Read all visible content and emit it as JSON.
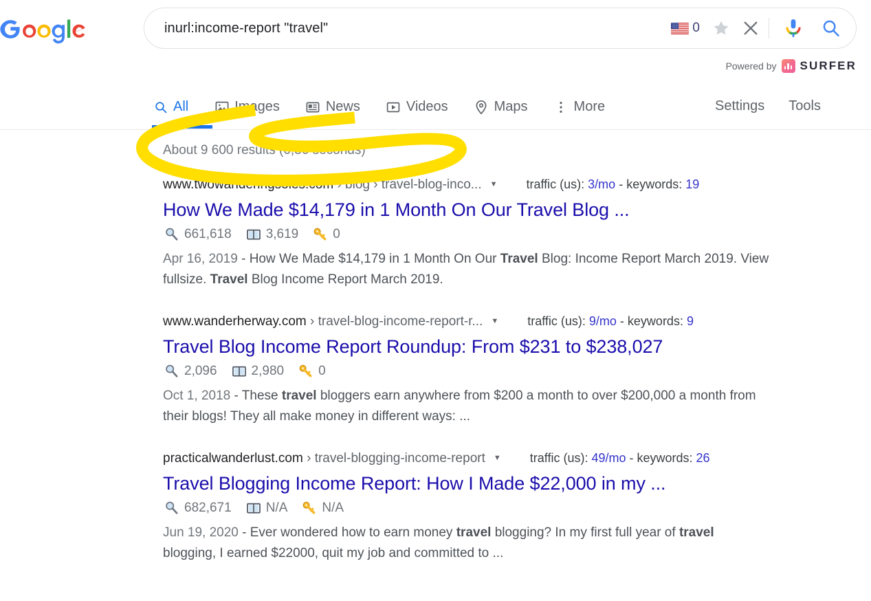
{
  "brand": {
    "logo_name": "google-logo",
    "logo_letters": "Google",
    "colors": {
      "blue": "#4285f4",
      "red": "#ea4335",
      "yellow": "#fbbc05",
      "green": "#34a853",
      "link": "#1a0dab",
      "tab_active": "#1a73e8",
      "highlight": "#ffde00"
    }
  },
  "search": {
    "query": "inurl:income-report \"travel\"",
    "placeholder": "Search",
    "flag_icon": "us-flag-icon",
    "flag_count": "0",
    "star_icon": "star-icon",
    "clear_icon": "close-icon",
    "mic_icon": "microphone-icon",
    "search_icon": "search-icon"
  },
  "powered_by": {
    "label": "Powered by",
    "product": "SURFER",
    "icon": "surfer-bars-icon"
  },
  "tabs": [
    {
      "label": "All",
      "icon": "search-icon",
      "active": true
    },
    {
      "label": "Images",
      "icon": "image-icon",
      "active": false
    },
    {
      "label": "News",
      "icon": "newspaper-icon",
      "active": false
    },
    {
      "label": "Videos",
      "icon": "play-icon",
      "active": false
    },
    {
      "label": "Maps",
      "icon": "pin-icon",
      "active": false
    },
    {
      "label": "More",
      "icon": "kebab-icon",
      "active": false
    }
  ],
  "tools": [
    {
      "label": "Settings"
    },
    {
      "label": "Tools"
    }
  ],
  "result_stats": "About 9 600 results (0,36 seconds)",
  "annotation": {
    "type": "hand-drawn-yellow-oval-highlight",
    "target": "result_stats",
    "color": "#ffde00"
  },
  "results": [
    {
      "domain": "www.twowanderingsoles.com",
      "crumbs": " › blog › travel-blog-inco...",
      "caret": "▼",
      "traffic_label": "traffic (us): ",
      "traffic_value": "3/mo",
      "separator": " - ",
      "keywords_label": "keywords: ",
      "keywords_value": "19",
      "title": "How We Made $14,179 in 1 Month On Our Travel Blog ...",
      "stats": [
        {
          "icon": "magnifier-icon",
          "value": "661,618"
        },
        {
          "icon": "book-icon",
          "value": "3,619"
        },
        {
          "icon": "key-icon",
          "value": "0"
        }
      ],
      "date": "Apr 16, 2019",
      "snippet_parts": [
        {
          "text": " - How We Made $14,179 in 1 Month On Our ",
          "bold": false
        },
        {
          "text": "Travel",
          "bold": true
        },
        {
          "text": " Blog: Income Report March 2019. View fullsize. ",
          "bold": false
        },
        {
          "text": "Travel",
          "bold": true
        },
        {
          "text": " Blog Income Report March 2019.",
          "bold": false
        }
      ]
    },
    {
      "domain": "www.wanderherway.com",
      "crumbs": " › travel-blog-income-report-r...",
      "caret": "▼",
      "traffic_label": "traffic (us): ",
      "traffic_value": "9/mo",
      "separator": " - ",
      "keywords_label": "keywords: ",
      "keywords_value": "9",
      "title": "Travel Blog Income Report Roundup: From $231 to $238,027",
      "stats": [
        {
          "icon": "magnifier-icon",
          "value": "2,096"
        },
        {
          "icon": "book-icon",
          "value": "2,980"
        },
        {
          "icon": "key-icon",
          "value": "0"
        }
      ],
      "date": "Oct 1, 2018",
      "snippet_parts": [
        {
          "text": " - These ",
          "bold": false
        },
        {
          "text": "travel",
          "bold": true
        },
        {
          "text": " bloggers earn anywhere from $200 a month to over $200,000 a month from their blogs! They all make money in different ways: ...",
          "bold": false
        }
      ]
    },
    {
      "domain": "practicalwanderlust.com",
      "crumbs": " › travel-blogging-income-report",
      "caret": "▼",
      "traffic_label": "traffic (us): ",
      "traffic_value": "49/mo",
      "separator": " - ",
      "keywords_label": "keywords: ",
      "keywords_value": "26",
      "title": "Travel Blogging Income Report: How I Made $22,000 in my ...",
      "stats": [
        {
          "icon": "magnifier-icon",
          "value": "682,671"
        },
        {
          "icon": "book-icon",
          "value": "N/A"
        },
        {
          "icon": "key-icon",
          "value": "N/A"
        }
      ],
      "date": "Jun 19, 2020",
      "snippet_parts": [
        {
          "text": " - Ever wondered how to earn money ",
          "bold": false
        },
        {
          "text": "travel",
          "bold": true
        },
        {
          "text": " blogging? In my first full year of ",
          "bold": false
        },
        {
          "text": "travel",
          "bold": true
        },
        {
          "text": " blogging, I earned $22000, quit my job and committed to ...",
          "bold": false
        }
      ]
    }
  ]
}
